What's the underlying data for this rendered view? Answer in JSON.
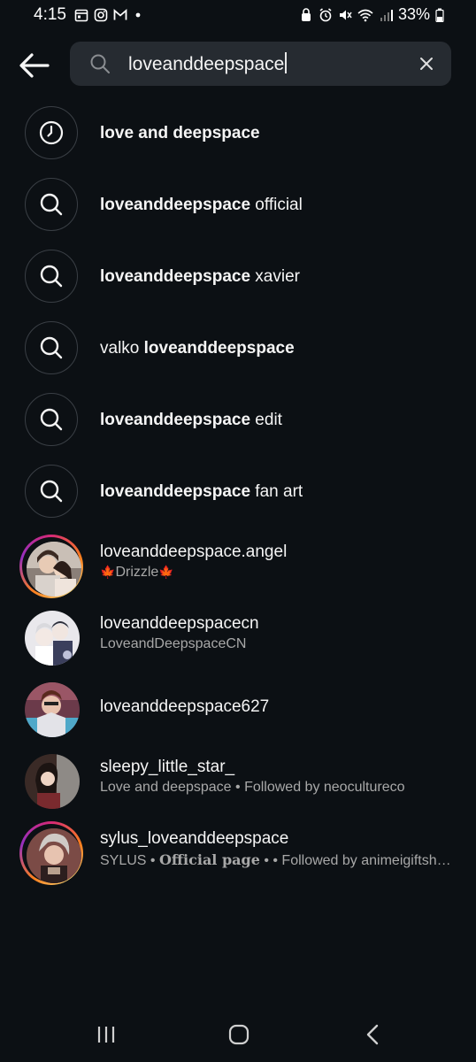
{
  "status_bar": {
    "time": "4:15",
    "battery": "33%"
  },
  "search": {
    "query": "loveanddeepspace"
  },
  "suggestions": [
    {
      "type": "recent",
      "icon": "clock-icon",
      "bold": "love and deepspace",
      "plain_before": "",
      "plain_after": ""
    },
    {
      "type": "search",
      "icon": "search-icon",
      "bold": "loveanddeepspace",
      "plain_before": "",
      "plain_after": " official"
    },
    {
      "type": "search",
      "icon": "search-icon",
      "bold": "loveanddeepspace",
      "plain_before": "",
      "plain_after": " xavier"
    },
    {
      "type": "search",
      "icon": "search-icon",
      "bold": "loveanddeepspace",
      "plain_before": "valko ",
      "plain_after": ""
    },
    {
      "type": "search",
      "icon": "search-icon",
      "bold": "loveanddeepspace",
      "plain_before": "",
      "plain_after": " edit"
    },
    {
      "type": "search",
      "icon": "search-icon",
      "bold": "loveanddeepspace",
      "plain_before": "",
      "plain_after": " fan art"
    }
  ],
  "accounts": [
    {
      "username": "loveanddeepspace.angel",
      "subtitle": "Drizzle",
      "has_story_ring": true
    },
    {
      "username": "loveanddeepspacecn",
      "subtitle": "LoveandDeepspaceCN",
      "has_story_ring": false
    },
    {
      "username": "loveanddeepspace627",
      "subtitle": "",
      "has_story_ring": false
    },
    {
      "username": "sleepy_little_star_",
      "subtitle": "Love and deepspace • Followed by neocultureco",
      "has_story_ring": false
    },
    {
      "username": "sylus_loveanddeepspace",
      "subtitle_prefix": "SYLUS  • ",
      "subtitle_official": "Official page",
      "subtitle_suffix": " • • Followed by animeigiftsh…",
      "has_story_ring": true
    }
  ],
  "colors": {
    "background": "#0c1014",
    "search_box": "#262b31",
    "secondary_text": "#a8a8a8",
    "story_ring_start": "#d62976",
    "story_ring_end": "#feda75"
  }
}
